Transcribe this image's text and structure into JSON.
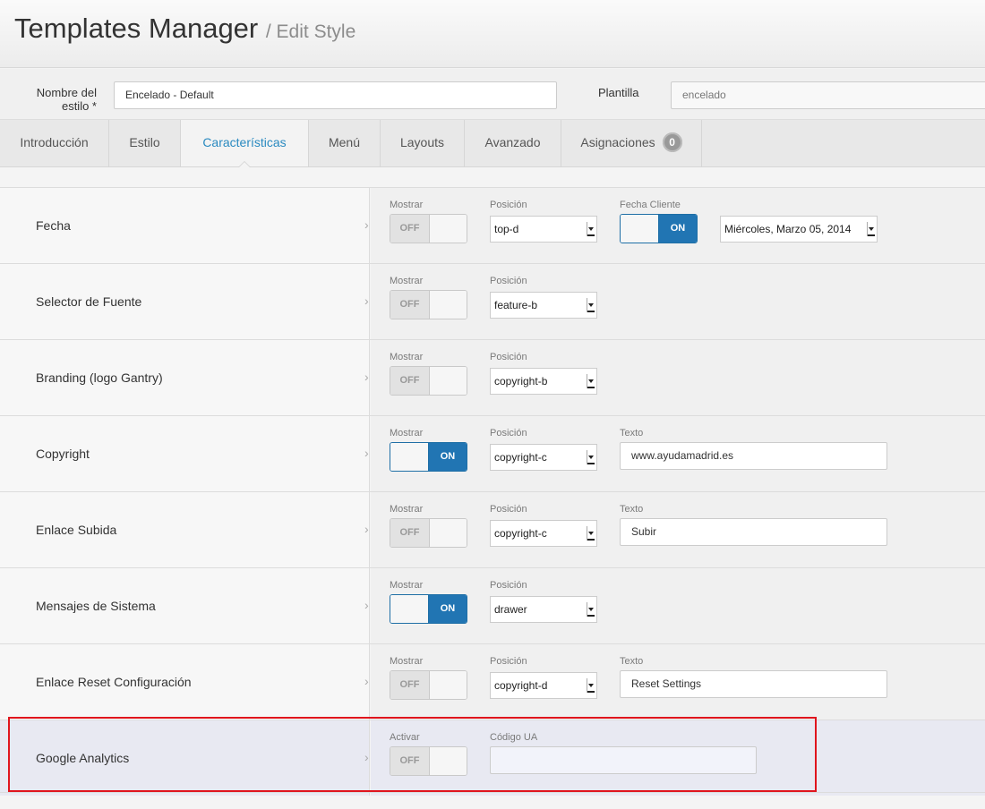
{
  "header": {
    "title": "Templates Manager",
    "subtitle": "/ Edit Style"
  },
  "style_bar": {
    "name_label": "Nombre del estilo *",
    "name_value": "Encelado - Default",
    "template_label": "Plantilla",
    "template_value": "encelado"
  },
  "tabs": [
    {
      "label": "Introducción"
    },
    {
      "label": "Estilo"
    },
    {
      "label": "Características"
    },
    {
      "label": "Menú"
    },
    {
      "label": "Layouts"
    },
    {
      "label": "Avanzado"
    },
    {
      "label": "Asignaciones",
      "badge": "0"
    }
  ],
  "labels": {
    "show": "Mostrar",
    "position": "Posición",
    "text": "Texto",
    "client_date": "Fecha Cliente",
    "activate": "Activar",
    "ua_code": "Código UA",
    "off": "OFF",
    "on": "ON"
  },
  "rows": [
    {
      "title": "Fecha",
      "show": "OFF",
      "position": "top-d",
      "client_date": "ON",
      "date_format": "Miércoles, Marzo 05, 2014"
    },
    {
      "title": "Selector de Fuente",
      "show": "OFF",
      "position": "feature-b"
    },
    {
      "title": "Branding (logo Gantry)",
      "show": "OFF",
      "position": "copyright-b"
    },
    {
      "title": "Copyright",
      "show": "ON",
      "position": "copyright-c",
      "text": "www.ayudamadrid.es"
    },
    {
      "title": "Enlace Subida",
      "show": "OFF",
      "position": "copyright-c",
      "text": "Subir"
    },
    {
      "title": "Mensajes de Sistema",
      "show": "ON",
      "position": "drawer"
    },
    {
      "title": "Enlace Reset Configuración",
      "show": "OFF",
      "position": "copyright-d",
      "text": "Reset Settings"
    },
    {
      "title": "Google Analytics",
      "activate": "OFF",
      "ua_code": ""
    }
  ],
  "colors": {
    "accent": "#2a8ac0",
    "toggle_on": "#2175b3",
    "highlight": "#e0151d"
  }
}
